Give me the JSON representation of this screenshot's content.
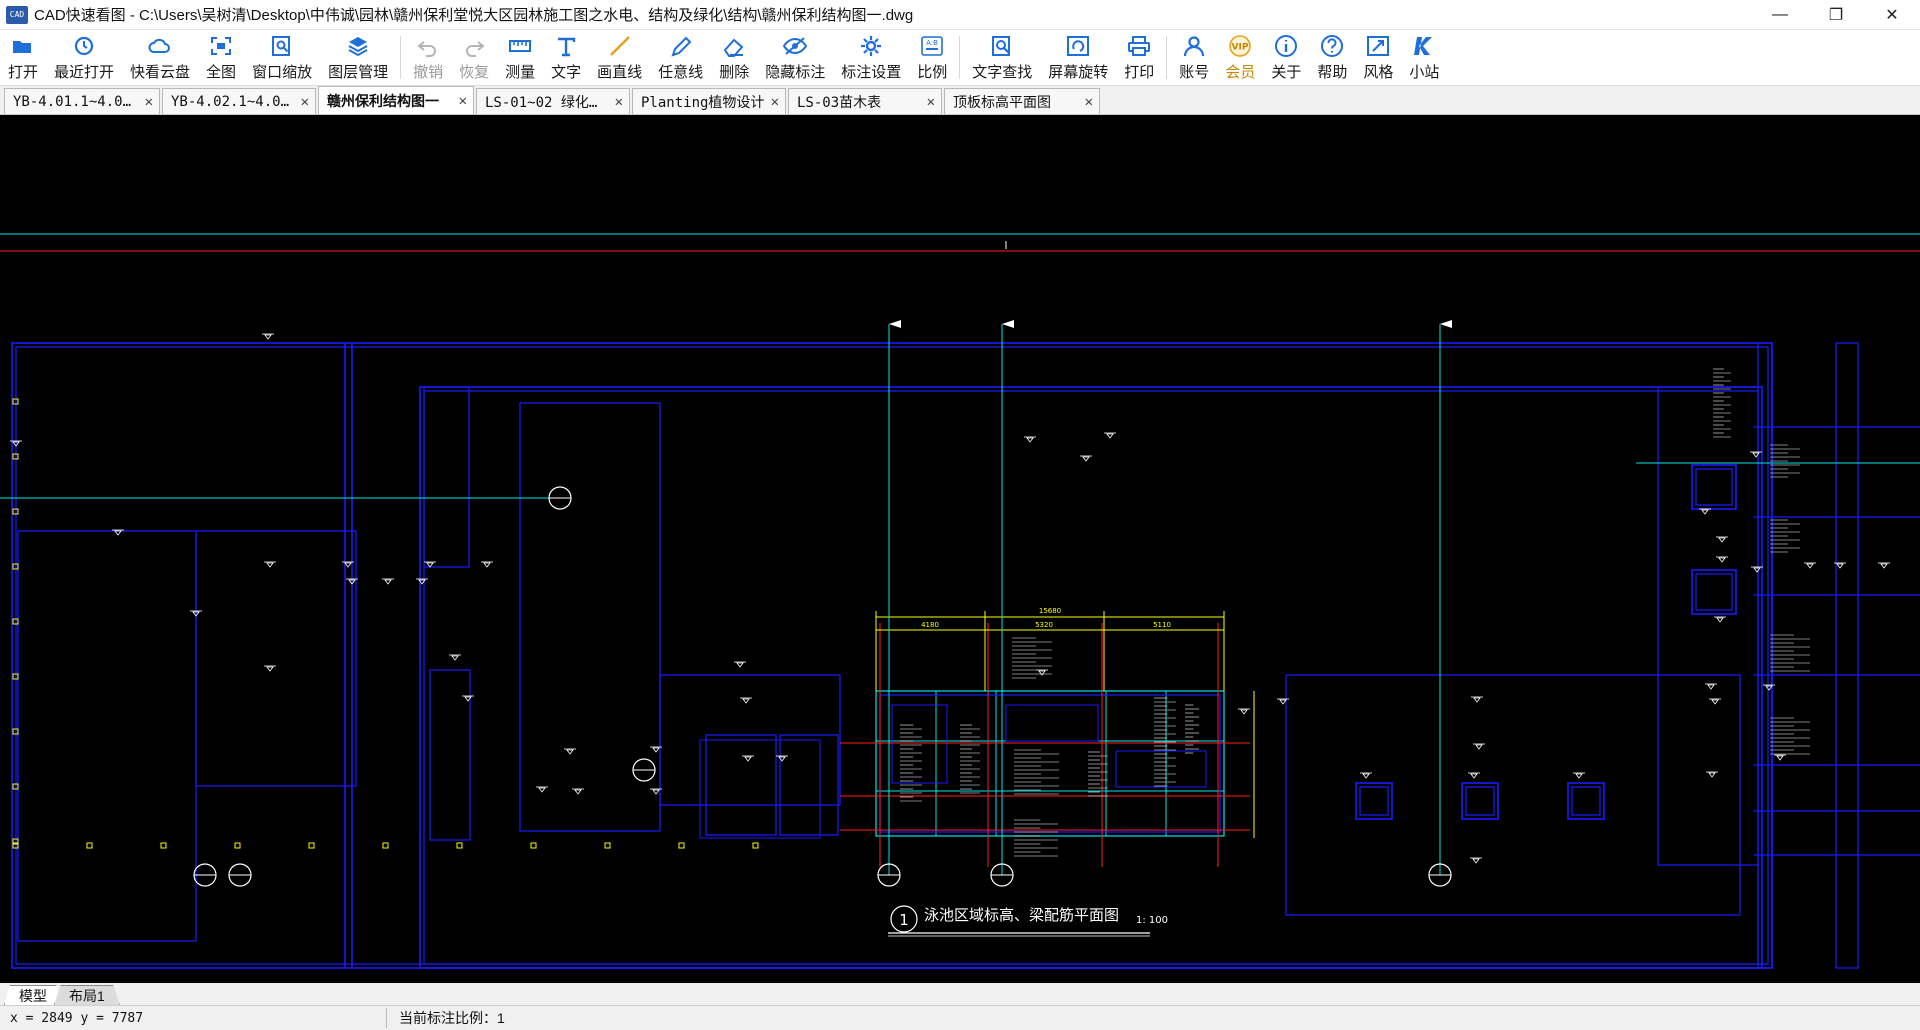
{
  "window": {
    "title": "CAD快速看图 - C:\\Users\\吴树清\\Desktop\\中伟诚\\园林\\赣州保利堂悦大区园林施工图之水电、结构及绿化\\结构\\赣州保利结构图一.dwg",
    "logo_text": "CAD",
    "controls": {
      "minimize": "—",
      "restore": "❐",
      "close": "✕"
    }
  },
  "toolbar": {
    "items": [
      {
        "name": "open",
        "label": "打开",
        "icon": "folder-icon",
        "disabled": false
      },
      {
        "name": "recent",
        "label": "最近打开",
        "icon": "history-icon",
        "disabled": false
      },
      {
        "name": "cloud",
        "label": "快看云盘",
        "icon": "cloud-icon",
        "disabled": false
      },
      {
        "name": "fullview",
        "label": "全图",
        "icon": "fullview-icon",
        "disabled": false
      },
      {
        "name": "zoomwin",
        "label": "窗口缩放",
        "icon": "zoom-window-icon",
        "disabled": false
      },
      {
        "name": "layers",
        "label": "图层管理",
        "icon": "layers-icon",
        "disabled": false
      },
      {
        "name": "undo",
        "label": "撤销",
        "icon": "undo-icon",
        "disabled": true
      },
      {
        "name": "redo",
        "label": "恢复",
        "icon": "redo-icon",
        "disabled": true
      },
      {
        "name": "measure",
        "label": "测量",
        "icon": "ruler-icon",
        "disabled": false
      },
      {
        "name": "text",
        "label": "文字",
        "icon": "text-icon",
        "disabled": false
      },
      {
        "name": "line",
        "label": "画直线",
        "icon": "line-icon",
        "disabled": false
      },
      {
        "name": "freeline",
        "label": "任意线",
        "icon": "pen-icon",
        "disabled": false
      },
      {
        "name": "delete",
        "label": "删除",
        "icon": "eraser-icon",
        "disabled": false
      },
      {
        "name": "hide",
        "label": "隐藏标注",
        "icon": "eye-icon",
        "disabled": false
      },
      {
        "name": "markset",
        "label": "标注设置",
        "icon": "gear-icon",
        "disabled": false
      },
      {
        "name": "scale",
        "label": "比例",
        "icon": "scale-icon",
        "disabled": false
      },
      {
        "name": "findtext",
        "label": "文字查找",
        "icon": "search-icon",
        "disabled": false
      },
      {
        "name": "rotate",
        "label": "屏幕旋转",
        "icon": "rotate-icon",
        "disabled": false
      },
      {
        "name": "print",
        "label": "打印",
        "icon": "printer-icon",
        "disabled": false
      },
      {
        "name": "account",
        "label": "账号",
        "icon": "user-icon",
        "disabled": false
      },
      {
        "name": "vip",
        "label": "会员",
        "icon": "vip-icon",
        "disabled": false
      },
      {
        "name": "about",
        "label": "关于",
        "icon": "info-icon",
        "disabled": false
      },
      {
        "name": "help",
        "label": "帮助",
        "icon": "help-icon",
        "disabled": false
      },
      {
        "name": "style",
        "label": "风格",
        "icon": "style-icon",
        "disabled": false
      },
      {
        "name": "station",
        "label": "小站",
        "icon": "k-icon",
        "disabled": false
      }
    ],
    "vip_badge": "VIP",
    "scale_badge": "A:B"
  },
  "tabs": [
    {
      "label": "YB-4.01.1~4.0…",
      "active": false
    },
    {
      "label": "YB-4.02.1~4.0…",
      "active": false
    },
    {
      "label": "赣州保利结构图一",
      "active": true
    },
    {
      "label": "LS-01~02 绿化…",
      "active": false
    },
    {
      "label": "Planting植物设计",
      "active": false
    },
    {
      "label": "LS-03苗木表",
      "active": false
    },
    {
      "label": "顶板标高平面图",
      "active": false
    }
  ],
  "drawing": {
    "caption_number": "1",
    "caption_title": "泳池区域标高、梁配筋平面图",
    "caption_scale": "1: 100",
    "dim_total": "15680",
    "dims": [
      "4180",
      "5320",
      "5110"
    ],
    "colors": {
      "background": "#000000",
      "wall": "#1a1aff",
      "cyan": "#00e5e5",
      "red": "#ff2020",
      "yellow": "#ffff00",
      "white": "#ffffff"
    }
  },
  "layout_tabs": [
    {
      "label": "模型",
      "active": true
    },
    {
      "label": "布局1",
      "active": false
    }
  ],
  "status": {
    "coords": "x = 2849  y = 7787",
    "scale": "当前标注比例：1"
  }
}
